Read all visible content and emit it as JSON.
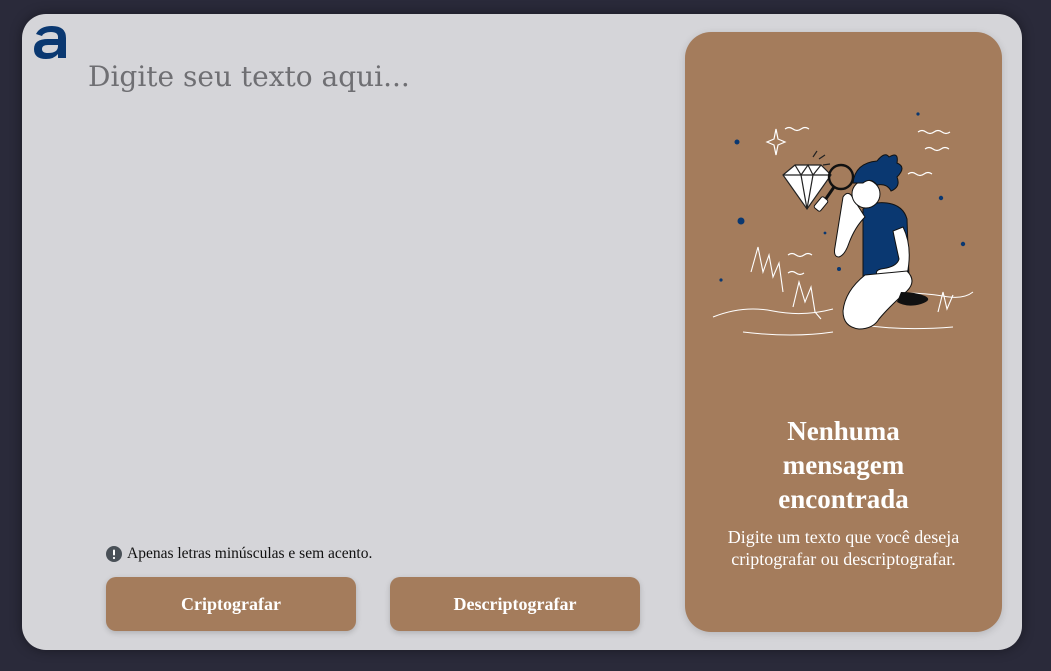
{
  "input": {
    "placeholder": "Digite seu texto aqui..."
  },
  "hint": {
    "icon": "exclamation-circle-icon",
    "text": "Apenas letras minúsculas e sem acento."
  },
  "buttons": {
    "encrypt_label": "Criptografar",
    "decrypt_label": "Descriptografar"
  },
  "output_panel": {
    "title": "Nenhuma mensagem encontrada",
    "subtitle": "Digite um texto que você deseja criptografar ou descriptografar.",
    "illustration": "person-with-magnifying-glass-diamond-illustration"
  },
  "colors": {
    "background": "#2a2a3a",
    "card": "#d5d5d9",
    "accent": "#a47c5c",
    "brand": "#0a3871",
    "text_placeholder": "#6f6f73"
  }
}
